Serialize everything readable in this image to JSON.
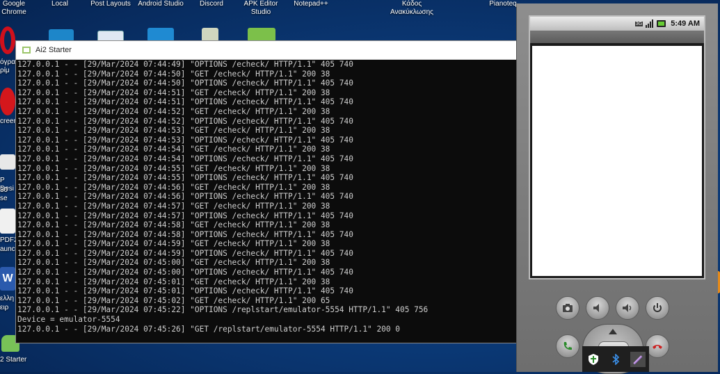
{
  "desktop": {
    "top_icons": [
      "Google Chrome",
      "Local",
      "Post Layouts",
      "Android Studio",
      "Discord",
      "APK Editor Studio",
      "Notepad++",
      "Κάδος Ανακύκλωσης",
      "Pianoteq"
    ],
    "left_labels": [
      "όγρα ρίμ",
      "creen",
      "P Desi",
      "30 se",
      "PDF2",
      "aunch",
      "ελλη",
      "ειρ",
      "2 Starter"
    ]
  },
  "console": {
    "title": "Ai2 Starter",
    "lines": [
      "127.0.0.1 - - [29/Mar/2024 07:44:49] \"OPTIONS /echeck/ HTTP/1.1\" 405 740",
      "127.0.0.1 - - [29/Mar/2024 07:44:50] \"GET /echeck/ HTTP/1.1\" 200 38",
      "127.0.0.1 - - [29/Mar/2024 07:44:50] \"OPTIONS /echeck/ HTTP/1.1\" 405 740",
      "127.0.0.1 - - [29/Mar/2024 07:44:51] \"GET /echeck/ HTTP/1.1\" 200 38",
      "127.0.0.1 - - [29/Mar/2024 07:44:51] \"OPTIONS /echeck/ HTTP/1.1\" 405 740",
      "127.0.0.1 - - [29/Mar/2024 07:44:52] \"GET /echeck/ HTTP/1.1\" 200 38",
      "127.0.0.1 - - [29/Mar/2024 07:44:52] \"OPTIONS /echeck/ HTTP/1.1\" 405 740",
      "127.0.0.1 - - [29/Mar/2024 07:44:53] \"GET /echeck/ HTTP/1.1\" 200 38",
      "127.0.0.1 - - [29/Mar/2024 07:44:53] \"OPTIONS /echeck/ HTTP/1.1\" 405 740",
      "127.0.0.1 - - [29/Mar/2024 07:44:54] \"GET /echeck/ HTTP/1.1\" 200 38",
      "127.0.0.1 - - [29/Mar/2024 07:44:54] \"OPTIONS /echeck/ HTTP/1.1\" 405 740",
      "127.0.0.1 - - [29/Mar/2024 07:44:55] \"GET /echeck/ HTTP/1.1\" 200 38",
      "127.0.0.1 - - [29/Mar/2024 07:44:55] \"OPTIONS /echeck/ HTTP/1.1\" 405 740",
      "127.0.0.1 - - [29/Mar/2024 07:44:56] \"GET /echeck/ HTTP/1.1\" 200 38",
      "127.0.0.1 - - [29/Mar/2024 07:44:56] \"OPTIONS /echeck/ HTTP/1.1\" 405 740",
      "127.0.0.1 - - [29/Mar/2024 07:44:57] \"GET /echeck/ HTTP/1.1\" 200 38",
      "127.0.0.1 - - [29/Mar/2024 07:44:57] \"OPTIONS /echeck/ HTTP/1.1\" 405 740",
      "127.0.0.1 - - [29/Mar/2024 07:44:58] \"GET /echeck/ HTTP/1.1\" 200 38",
      "127.0.0.1 - - [29/Mar/2024 07:44:58] \"OPTIONS /echeck/ HTTP/1.1\" 405 740",
      "127.0.0.1 - - [29/Mar/2024 07:44:59] \"GET /echeck/ HTTP/1.1\" 200 38",
      "127.0.0.1 - - [29/Mar/2024 07:44:59] \"OPTIONS /echeck/ HTTP/1.1\" 405 740",
      "127.0.0.1 - - [29/Mar/2024 07:45:00] \"GET /echeck/ HTTP/1.1\" 200 38",
      "127.0.0.1 - - [29/Mar/2024 07:45:00] \"OPTIONS /echeck/ HTTP/1.1\" 405 740",
      "127.0.0.1 - - [29/Mar/2024 07:45:01] \"GET /echeck/ HTTP/1.1\" 200 38",
      "127.0.0.1 - - [29/Mar/2024 07:45:01] \"OPTIONS /echeck/ HTTP/1.1\" 405 740",
      "127.0.0.1 - - [29/Mar/2024 07:45:02] \"GET /echeck/ HTTP/1.1\" 200 65",
      "127.0.0.1 - - [29/Mar/2024 07:45:22] \"OPTIONS /replstart/emulator-5554 HTTP/1.1\" 405 756",
      "Device = emulator-5554",
      "127.0.0.1 - - [29/Mar/2024 07:45:26] \"GET /replstart/emulator-5554 HTTP/1.1\" 200 0"
    ]
  },
  "emulator": {
    "status_network": "3G",
    "status_time": "5:49",
    "status_ampm": "AM"
  },
  "colors": {
    "desktop_bg": "#0b3a78",
    "console_bg": "#0c0c0c",
    "console_text": "#cfcfcf",
    "emulator_body": "#8e8e8e"
  }
}
